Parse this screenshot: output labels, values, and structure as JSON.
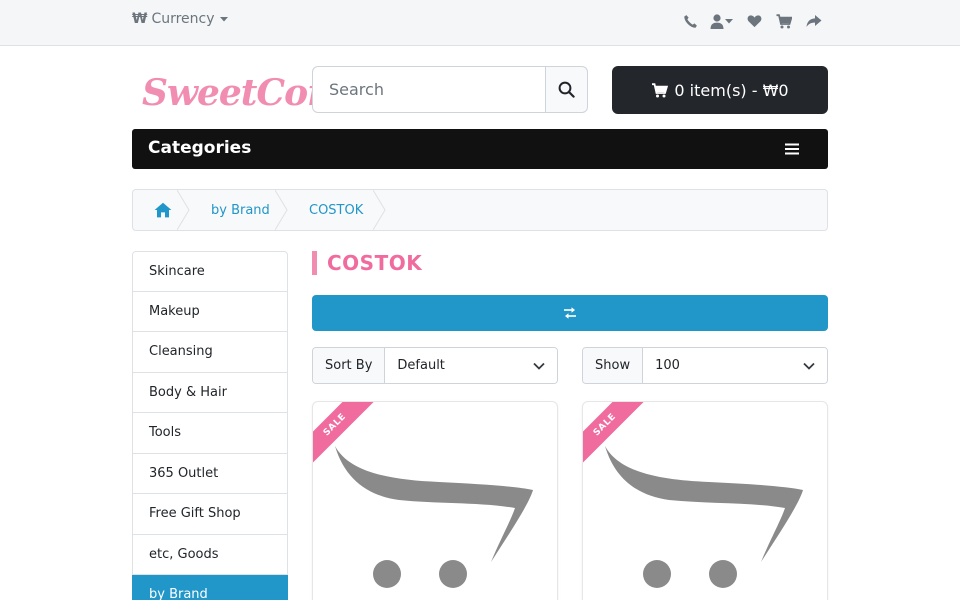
{
  "topbar": {
    "currency_symbol": "₩",
    "currency_label": "Currency",
    "links": [
      {
        "icon": "phone-icon"
      },
      {
        "icon": "user-icon"
      },
      {
        "icon": "heart-icon"
      },
      {
        "icon": "cart-icon"
      },
      {
        "icon": "share-icon"
      }
    ]
  },
  "header": {
    "logo_text": "SweetCorea",
    "search_placeholder": "Search",
    "cart_label": "0 item(s) - ₩0"
  },
  "nav": {
    "categories_label": "Categories"
  },
  "breadcrumb": {
    "items": [
      "by Brand",
      "COSTOK"
    ]
  },
  "sidebar": {
    "items": [
      {
        "label": "Skincare",
        "active": false
      },
      {
        "label": "Makeup",
        "active": false
      },
      {
        "label": "Cleansing",
        "active": false
      },
      {
        "label": "Body & Hair",
        "active": false
      },
      {
        "label": "Tools",
        "active": false
      },
      {
        "label": "365 Outlet",
        "active": false
      },
      {
        "label": "Free Gift Shop",
        "active": false
      },
      {
        "label": "etc, Goods",
        "active": false
      },
      {
        "label": "by Brand",
        "active": true
      }
    ]
  },
  "main": {
    "title": "COSTOK",
    "sort_label": "Sort By",
    "sort_value": "Default",
    "show_label": "Show",
    "show_value": "100",
    "products": [
      {
        "badge": "SALE"
      },
      {
        "badge": "SALE"
      }
    ]
  },
  "colors": {
    "accent": "#2196c9",
    "pink": "#f06b9e",
    "dark": "#111111"
  }
}
